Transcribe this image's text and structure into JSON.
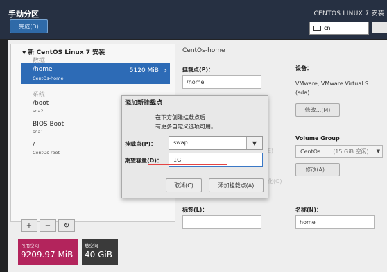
{
  "header": {
    "title": "手动分区",
    "done_label": "完成(D)",
    "product": "CENTOS LINUX 7 安装",
    "keyboard": "cn"
  },
  "tree": {
    "header": "新 CentOS Linux 7 安装",
    "section_data": "数据",
    "section_system": "系统",
    "selected": {
      "name": "/home",
      "device": "CentOs-home",
      "size": "5120 MiB"
    },
    "items": [
      {
        "name": "/boot",
        "device": "sda2"
      },
      {
        "name": "BIOS Boot",
        "device": "sda1"
      },
      {
        "name": "/",
        "device": "CentOs-root"
      }
    ],
    "buttons": {
      "add": "+",
      "remove": "−",
      "refresh": "↻"
    }
  },
  "space": {
    "available_label": "可用空间",
    "available_value": "9209.97 MiB",
    "total_label": "总空间",
    "total_value": "40 GiB",
    "available_color": "#b3245c",
    "total_color": "#3a3a3a"
  },
  "details": {
    "title": "CentOs-home",
    "mount_label": "挂载点(P)：",
    "mount_value": "/home",
    "device_label": "设备：",
    "device_desc_1": "VMware, VMware Virtual S",
    "device_desc_2": "(sda)",
    "modify_label": "修改...(M)",
    "vg_label": "Volume Group",
    "vg_name": "CentOs",
    "vg_free": "(15 GiB 空闲)",
    "vg_modify_label": "修改(A)...",
    "tag_label": "标签(L)：",
    "tag_value": "",
    "name_label": "名称(N)：",
    "name_value": "home",
    "ghost_e": "E)",
    "ghost_a": "化(O)"
  },
  "dialog": {
    "title": "添加新挂载点",
    "message_1": "在下方创建挂载点后",
    "message_2": "有更多自定义选项可用。",
    "mount_label": "挂载点(P)：",
    "mount_value": "swap",
    "capacity_label": "期望容量(D)：",
    "capacity_value": "1G",
    "cancel_label": "取消(C)",
    "add_label": "添加挂载点(A)"
  }
}
